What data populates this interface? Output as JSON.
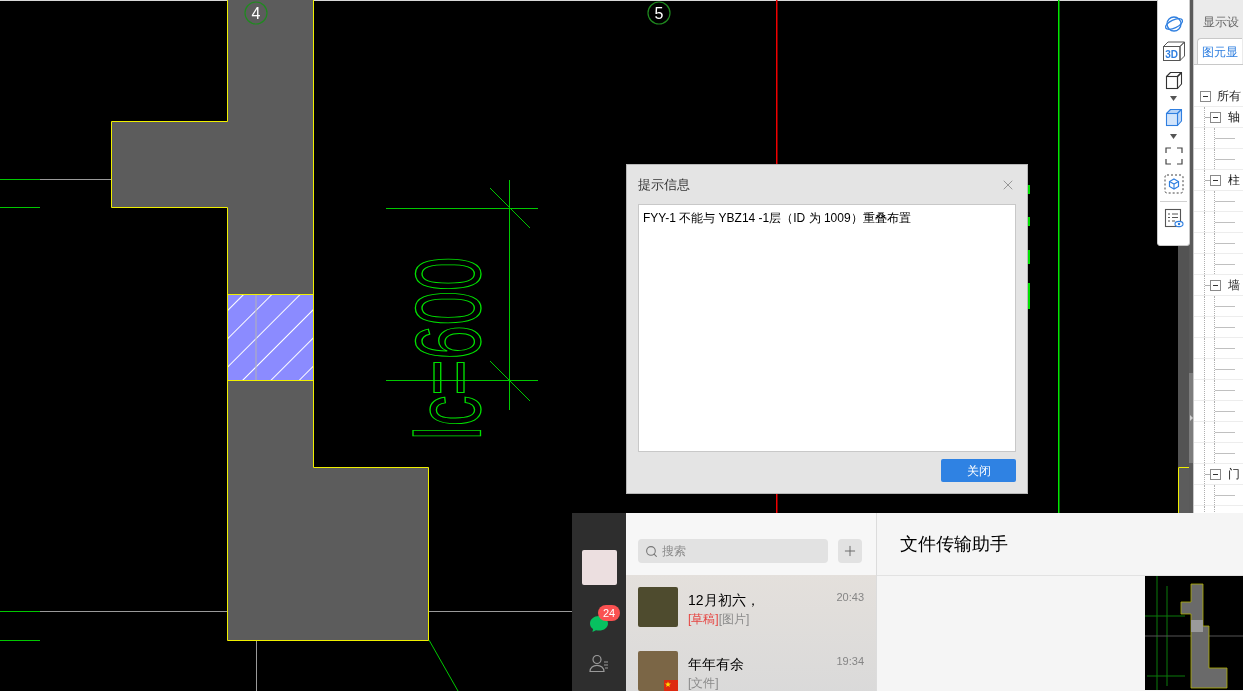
{
  "cad_drawing": {
    "axis_labels": [
      "4",
      "5"
    ],
    "dimension_text": "lc=600"
  },
  "view_toolbar": {
    "cube_label": "3D"
  },
  "display_panel": {
    "title": "显示设",
    "tab": {
      "label": "图元显",
      "selected": true
    },
    "tree": [
      {
        "label": "所有",
        "expanded": true,
        "children": [
          {
            "label": "轴",
            "expanded": true
          },
          {
            "label": "柱",
            "expanded": true
          },
          {
            "label": "墙",
            "expanded": true
          },
          {
            "label": "门",
            "expanded": true
          }
        ]
      }
    ]
  },
  "dialog": {
    "title": "提示信息",
    "message": "FYY-1 不能与 YBZ14 -1层（ID 为 1009）重叠布置",
    "buttons": [
      "关闭"
    ]
  },
  "chat_app": {
    "nav": [
      {
        "kind": "chats",
        "selected": true,
        "badge": "24"
      },
      {
        "kind": "contacts",
        "selected": false
      }
    ],
    "search": {
      "placeholder": "搜索"
    },
    "chats": [
      {
        "name": "12月初六，",
        "time": "20:43",
        "tag": "[草稿]",
        "preview": "[图片]"
      },
      {
        "name": "年年有余",
        "time": "19:34",
        "preview": "[文件]",
        "flag_badge": true
      }
    ],
    "conversation": {
      "title": "文件传输助手"
    }
  }
}
